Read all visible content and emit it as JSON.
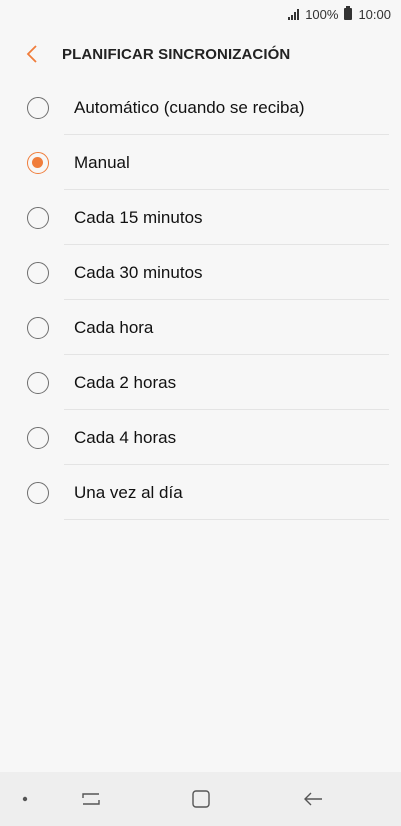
{
  "status_bar": {
    "battery": "100%",
    "time": "10:00"
  },
  "header": {
    "title": "PLANIFICAR SINCRONIZACIÓN",
    "back_icon": "chevron-left-icon"
  },
  "accent_color": "#f07d3b",
  "options": [
    {
      "label": "Automático (cuando se reciba)",
      "selected": false
    },
    {
      "label": "Manual",
      "selected": true
    },
    {
      "label": "Cada 15 minutos",
      "selected": false
    },
    {
      "label": "Cada 30 minutos",
      "selected": false
    },
    {
      "label": "Cada hora",
      "selected": false
    },
    {
      "label": "Cada 2 horas",
      "selected": false
    },
    {
      "label": "Cada 4 horas",
      "selected": false
    },
    {
      "label": "Una vez al día",
      "selected": false
    }
  ],
  "nav_bar": {
    "icons": [
      "dot-icon",
      "recent-apps-icon",
      "home-icon",
      "back-arrow-icon"
    ]
  }
}
